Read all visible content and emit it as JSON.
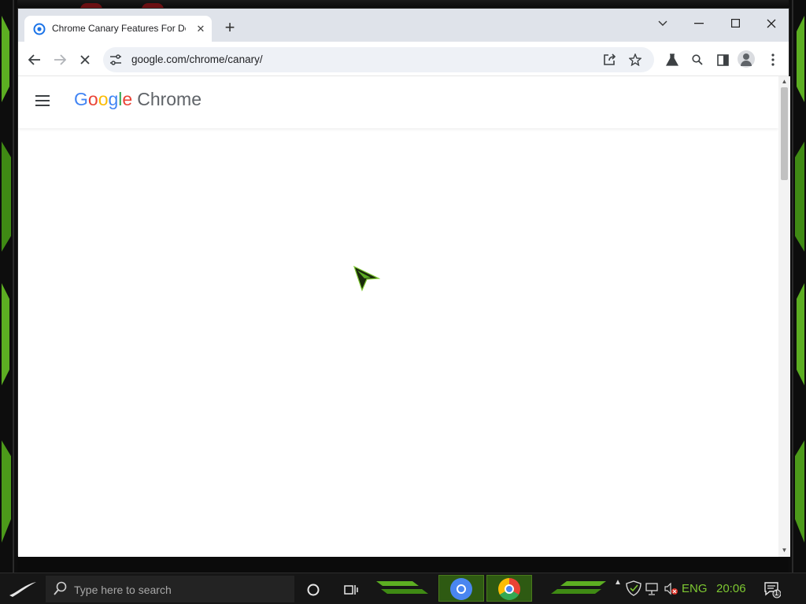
{
  "browser": {
    "tab_title": "Chrome Canary Features For De",
    "new_tab_symbol": "+",
    "tab_close_symbol": "✕",
    "url": "google.com/chrome/canary/",
    "window_controls": {
      "chevron": "⌄",
      "minimize": "—",
      "maximize": "☐",
      "close": "✕"
    }
  },
  "page": {
    "logo_google": [
      "G",
      "o",
      "o",
      "g",
      "l",
      "e"
    ],
    "logo_product": "Chrome"
  },
  "taskbar": {
    "search_placeholder": "Type here to search",
    "language": "ENG",
    "time": "20:06",
    "notification_count": "1"
  },
  "colors": {
    "accent_green": "#7ec832",
    "tab_strip": "#dfe3ea",
    "google_blue": "#4285f4",
    "google_red": "#ea4335",
    "google_yellow": "#fbbc05",
    "google_green": "#34a853"
  }
}
